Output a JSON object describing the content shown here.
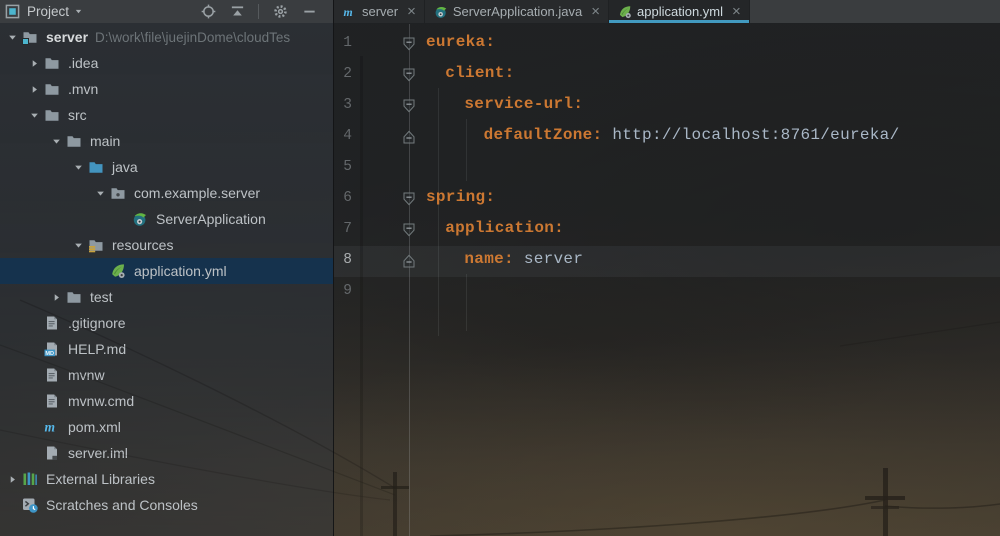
{
  "colors": {
    "accent_tab_underline": "#429ac0",
    "selection_row": "#15324d",
    "yaml_key": "#cc7832",
    "yaml_value": "#a9b7c6",
    "line_number": "#64686b"
  },
  "project_panel": {
    "header": {
      "title": "Project",
      "actions": [
        {
          "name": "locate-file",
          "icon": "locate"
        },
        {
          "name": "collapse-all",
          "icon": "collapse-all"
        },
        {
          "name": "separator"
        },
        {
          "name": "settings",
          "icon": "settings"
        },
        {
          "name": "hide-panel",
          "icon": "hide"
        }
      ]
    },
    "tree": [
      {
        "label": "server",
        "path": "D:\\work\\file\\juejinDome\\cloudTes",
        "icon": "folder-module",
        "arrow": "down",
        "level": 0,
        "bold": true
      },
      {
        "label": ".idea",
        "icon": "folder",
        "arrow": "right",
        "level": 1
      },
      {
        "label": ".mvn",
        "icon": "folder",
        "arrow": "right",
        "level": 1
      },
      {
        "label": "src",
        "icon": "folder",
        "arrow": "down",
        "level": 1
      },
      {
        "label": "main",
        "icon": "folder",
        "arrow": "down",
        "level": 2
      },
      {
        "label": "java",
        "icon": "folder-sources",
        "arrow": "down",
        "level": 3
      },
      {
        "label": "com.example.server",
        "icon": "package",
        "arrow": "down",
        "level": 4
      },
      {
        "label": "ServerApplication",
        "icon": "spring-boot",
        "arrow": "none",
        "level": 5
      },
      {
        "label": "resources",
        "icon": "folder-resources",
        "arrow": "down",
        "level": 3
      },
      {
        "label": "application.yml",
        "icon": "spring-yml",
        "arrow": "none",
        "level": 4,
        "selected": true
      },
      {
        "label": "test",
        "icon": "folder",
        "arrow": "right",
        "level": 2
      },
      {
        "label": ".gitignore",
        "icon": "file-text",
        "arrow": "none",
        "level": 1
      },
      {
        "label": "HELP.md",
        "icon": "file-md",
        "arrow": "none",
        "level": 1
      },
      {
        "label": "mvnw",
        "icon": "file-text",
        "arrow": "none",
        "level": 1
      },
      {
        "label": "mvnw.cmd",
        "icon": "file-text",
        "arrow": "none",
        "level": 1
      },
      {
        "label": "pom.xml",
        "icon": "maven",
        "arrow": "none",
        "level": 1
      },
      {
        "label": "server.iml",
        "icon": "file-iml",
        "arrow": "none",
        "level": 1
      },
      {
        "label": "External Libraries",
        "icon": "ext-lib",
        "arrow": "right",
        "level": 0
      },
      {
        "label": "Scratches and Consoles",
        "icon": "scratches",
        "arrow": "none",
        "level": 0
      }
    ]
  },
  "editor": {
    "tabs": [
      {
        "label": "server",
        "icon": "maven",
        "active": false,
        "close": "×"
      },
      {
        "label": "ServerApplication.java",
        "icon": "spring-boot",
        "active": false,
        "close": "×"
      },
      {
        "label": "application.yml",
        "icon": "spring-yml",
        "active": true,
        "close": "×"
      }
    ],
    "code": {
      "language": "yaml",
      "lines": [
        {
          "num": "1",
          "indent": 0,
          "key": "eureka:",
          "value": "",
          "fold": "open"
        },
        {
          "num": "2",
          "indent": 1,
          "key": "client:",
          "value": "",
          "fold": "open"
        },
        {
          "num": "3",
          "indent": 2,
          "key": "service-url:",
          "value": "",
          "fold": "open"
        },
        {
          "num": "4",
          "indent": 3,
          "key": "defaultZone:",
          "value": "http://localhost:8761/eureka/",
          "fold": "end"
        },
        {
          "num": "5",
          "indent": 0,
          "key": "",
          "value": "",
          "fold": ""
        },
        {
          "num": "6",
          "indent": 0,
          "key": "spring:",
          "value": "",
          "fold": "open"
        },
        {
          "num": "7",
          "indent": 1,
          "key": "application:",
          "value": "",
          "fold": "open"
        },
        {
          "num": "8",
          "indent": 2,
          "key": "name:",
          "value": "server",
          "fold": "end",
          "current": true
        },
        {
          "num": "9",
          "indent": 0,
          "key": "",
          "value": "",
          "fold": ""
        }
      ]
    }
  }
}
